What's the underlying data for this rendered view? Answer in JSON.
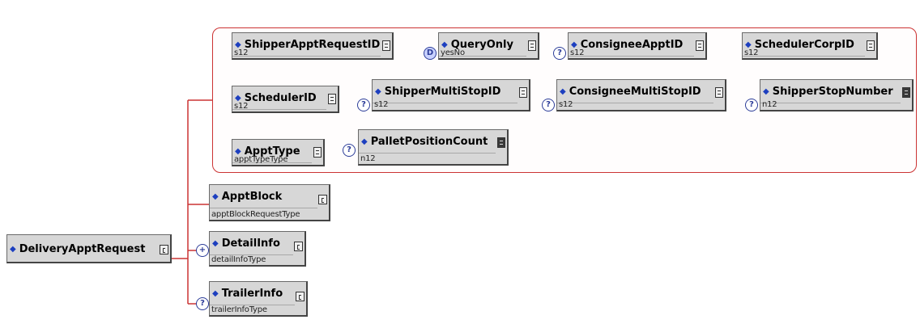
{
  "colors": {
    "connector": "#cc3333",
    "node_fill": "#d7d7d7",
    "node_border": "#555555",
    "diamond": "#1d3fbf",
    "badge": "#2d3d99"
  },
  "root": {
    "name": "DeliveryApptRequest",
    "icon": "diamond-icon",
    "button": "expand-c-icon"
  },
  "compositor": {
    "icon": "sequence-compositor-icon"
  },
  "group": {
    "compositor_icon": "sequence-compositor-icon",
    "fields": [
      {
        "name": "ShipperApptRequestID",
        "type": "s12",
        "optional": false
      },
      {
        "name": "QueryOnly",
        "type": "yesNo",
        "optional": true,
        "badge": "D"
      },
      {
        "name": "ConsigneeApptID",
        "type": "s12",
        "optional": true,
        "badge": "?"
      },
      {
        "name": "SchedulerCorpID",
        "type": "s12",
        "optional": false
      },
      {
        "name": "SchedulerID",
        "type": "s12",
        "optional": false
      },
      {
        "name": "ShipperMultiStopID",
        "type": "s12",
        "optional": true,
        "badge": "?"
      },
      {
        "name": "ConsigneeMultiStopID",
        "type": "s12",
        "optional": true,
        "badge": "?"
      },
      {
        "name": "ShipperStopNumber",
        "type": "n12",
        "optional": true,
        "badge": "?"
      },
      {
        "name": "ApptType",
        "type": "apptTypeType",
        "optional": false
      },
      {
        "name": "PalletPositionCount",
        "type": "n12",
        "optional": true,
        "badge": "?"
      }
    ]
  },
  "children": [
    {
      "name": "ApptBlock",
      "type": "apptBlockRequestType",
      "optional": false
    },
    {
      "name": "DetailInfo",
      "type": "detailInfoType",
      "optional": true,
      "badge": "+"
    },
    {
      "name": "TrailerInfo",
      "type": "trailerInfoType",
      "optional": true,
      "badge": "?"
    }
  ]
}
